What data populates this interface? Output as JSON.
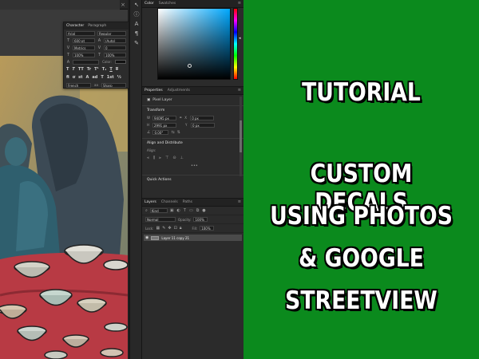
{
  "colors": {
    "background_green": "#0b8a1d",
    "title_text": "#ffffff",
    "title_outline": "#000000",
    "ui_dark": "#2b2b2b"
  },
  "char_panel": {
    "tabs": [
      "Character",
      "Paragraph"
    ],
    "font_family": "Arial",
    "font_style": "Regular",
    "font_size": "600 pt",
    "leading": "(Auto)",
    "kerning": "Metrics",
    "tracking": "0",
    "vertical_scale": "100%",
    "horizontal_scale": "100%",
    "color_label": "Color:",
    "glyph_buttons": [
      "T",
      "T",
      "TT",
      "Tr",
      "T¹",
      "T₁",
      "T",
      "T"
    ],
    "language": "French",
    "antialias": "aa",
    "antialias_method": "Sharp"
  },
  "tools": [
    "arrow-icon",
    "info-icon",
    "type-icon",
    "paragraph-icon",
    "brush-icon"
  ],
  "color_panel": {
    "tabs": [
      "Color",
      "Swatches"
    ]
  },
  "properties_panel": {
    "tabs": [
      "Properties",
      "Adjustments"
    ],
    "layer_kind": "Pixel Layer",
    "transform_label": "Transform",
    "w_label": "W",
    "w_value": "94095 px",
    "x_label": "X",
    "x_value": "0 px",
    "h_label": "H",
    "h_value": "2991 px",
    "y_label": "Y",
    "y_value": "0 px",
    "angle_value": "0.00°",
    "align_label": "Align and Distribute",
    "align_sub": "Align:",
    "quick_actions": "Quick Actions"
  },
  "layers_panel": {
    "tabs": [
      "Layers",
      "Channels",
      "Paths"
    ],
    "filter_kind": "Kind",
    "blend_mode": "Normal",
    "opacity_label": "Opacity:",
    "opacity_value": "100%",
    "lock_label": "Lock:",
    "fill_label": "Fill:",
    "fill_value": "100%",
    "layer_name": "Layer 11 copy 21"
  },
  "title_card": {
    "line1": "TUTORIAL",
    "line2": "CUSTOM DECALS",
    "line3": "USING PHOTOS",
    "line4": "& GOOGLE",
    "line5": "STREETVIEW"
  }
}
